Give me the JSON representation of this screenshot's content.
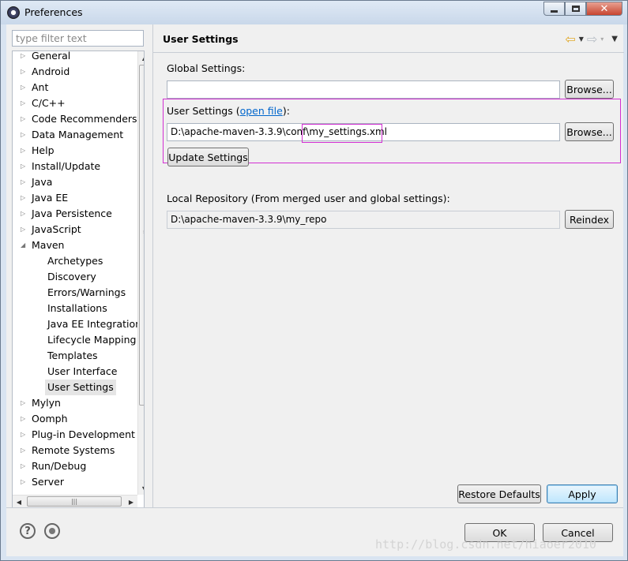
{
  "window": {
    "title": "Preferences",
    "icon": "eclipse-icon",
    "controls": {
      "minimize": "minimize-icon",
      "maximize": "maximize-icon",
      "close": "✕"
    }
  },
  "sidebar": {
    "filter_placeholder": "type filter text",
    "items": [
      {
        "label": "General",
        "expandable": true
      },
      {
        "label": "Android",
        "expandable": true
      },
      {
        "label": "Ant",
        "expandable": true
      },
      {
        "label": "C/C++",
        "expandable": true
      },
      {
        "label": "Code Recommenders",
        "expandable": true
      },
      {
        "label": "Data Management",
        "expandable": true
      },
      {
        "label": "Help",
        "expandable": true
      },
      {
        "label": "Install/Update",
        "expandable": true
      },
      {
        "label": "Java",
        "expandable": true
      },
      {
        "label": "Java EE",
        "expandable": true
      },
      {
        "label": "Java Persistence",
        "expandable": true
      },
      {
        "label": "JavaScript",
        "expandable": true
      },
      {
        "label": "Maven",
        "expanded": true
      },
      {
        "label": "Archetypes",
        "child": true
      },
      {
        "label": "Discovery",
        "child": true
      },
      {
        "label": "Errors/Warnings",
        "child": true
      },
      {
        "label": "Installations",
        "child": true
      },
      {
        "label": "Java EE Integration",
        "child": true
      },
      {
        "label": "Lifecycle Mapping",
        "child": true
      },
      {
        "label": "Templates",
        "child": true
      },
      {
        "label": "User Interface",
        "child": true
      },
      {
        "label": "User Settings",
        "child": true,
        "selected": true
      },
      {
        "label": "Mylyn",
        "expandable": true
      },
      {
        "label": "Oomph",
        "expandable": true
      },
      {
        "label": "Plug-in Development",
        "expandable": true
      },
      {
        "label": "Remote Systems",
        "expandable": true
      },
      {
        "label": "Run/Debug",
        "expandable": true
      },
      {
        "label": "Server",
        "expandable": true
      }
    ]
  },
  "page": {
    "title": "User Settings",
    "nav": {
      "back": "⇦",
      "forward": "⇨",
      "dropdown": "▾",
      "menu": "▼"
    },
    "global_settings_label": "Global Settings:",
    "global_settings_value": "",
    "browse_label": "Browse...",
    "user_settings_label": "User Settings (",
    "open_file_link": "open file",
    "user_settings_label_end": "):",
    "user_settings_path": "D:\\apache-maven-3.3.9\\conf\\",
    "user_settings_file": "my_settings.xml",
    "update_settings_label": "Update Settings",
    "local_repo_label": "Local Repository (From merged user and global settings):",
    "local_repo_value": "D:\\apache-maven-3.3.9\\my_repo",
    "reindex_label": "Reindex",
    "restore_defaults_label": "Restore Defaults",
    "apply_label": "Apply"
  },
  "footer": {
    "help_icon": "?",
    "ok_label": "OK",
    "cancel_label": "Cancel",
    "watermark": "http://blog.csdn.net/hiaoer2010"
  }
}
